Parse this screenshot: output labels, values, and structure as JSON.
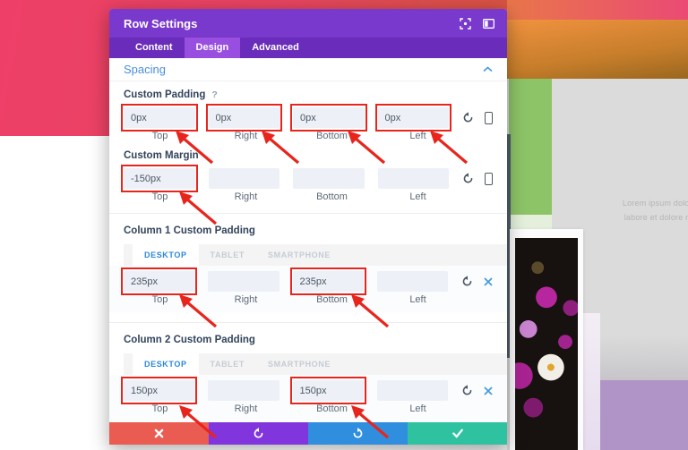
{
  "window": {
    "title": "Row Settings",
    "header_icons": [
      "expand-icon",
      "dock-icon"
    ]
  },
  "tabs": [
    {
      "label": "Content",
      "active": false
    },
    {
      "label": "Design",
      "active": true
    },
    {
      "label": "Advanced",
      "active": false
    }
  ],
  "section": {
    "title": "Spacing",
    "toggle_icon": "chevron-up-icon"
  },
  "groups": [
    {
      "label": "Custom Padding",
      "help": "?",
      "fields": [
        {
          "label": "Top",
          "value": "0px",
          "highlighted": true
        },
        {
          "label": "Right",
          "value": "0px",
          "highlighted": true
        },
        {
          "label": "Bottom",
          "value": "0px",
          "highlighted": true
        },
        {
          "label": "Left",
          "value": "0px",
          "highlighted": true
        }
      ],
      "actions": [
        "reset-icon",
        "phone-icon"
      ]
    },
    {
      "label": "Custom Margin",
      "fields": [
        {
          "label": "Top",
          "value": "-150px",
          "highlighted": true
        },
        {
          "label": "Right",
          "value": "",
          "highlighted": false
        },
        {
          "label": "Bottom",
          "value": "",
          "highlighted": false
        },
        {
          "label": "Left",
          "value": "",
          "highlighted": false
        }
      ],
      "actions": [
        "reset-icon",
        "phone-icon"
      ]
    },
    {
      "label": "Column 1 Custom Padding",
      "device_tabs": [
        {
          "label": "DESKTOP",
          "active": true
        },
        {
          "label": "TABLET",
          "active": false
        },
        {
          "label": "SMARTPHONE",
          "active": false
        }
      ],
      "fields": [
        {
          "label": "Top",
          "value": "235px",
          "highlighted": true
        },
        {
          "label": "Right",
          "value": "",
          "highlighted": false
        },
        {
          "label": "Bottom",
          "value": "235px",
          "highlighted": true
        },
        {
          "label": "Left",
          "value": "",
          "highlighted": false
        }
      ],
      "actions": [
        "reset-icon",
        "close-icon"
      ]
    },
    {
      "label": "Column 2 Custom Padding",
      "device_tabs": [
        {
          "label": "DESKTOP",
          "active": true
        },
        {
          "label": "TABLET",
          "active": false
        },
        {
          "label": "SMARTPHONE",
          "active": false
        }
      ],
      "fields": [
        {
          "label": "Top",
          "value": "150px",
          "highlighted": true
        },
        {
          "label": "Right",
          "value": "",
          "highlighted": false
        },
        {
          "label": "Bottom",
          "value": "150px",
          "highlighted": true
        },
        {
          "label": "Left",
          "value": "",
          "highlighted": false
        }
      ],
      "actions": [
        "reset-icon",
        "close-icon"
      ]
    }
  ],
  "footer": {
    "buttons": [
      {
        "name": "cancel",
        "icon": "x-icon",
        "color": "#ea5c51"
      },
      {
        "name": "undo",
        "icon": "undo-icon",
        "color": "#8135dc"
      },
      {
        "name": "redo",
        "icon": "redo-icon",
        "color": "#2f8ede"
      },
      {
        "name": "save",
        "icon": "check-icon",
        "color": "#2fc2a0"
      }
    ]
  },
  "background_page": {
    "paragraph_line1": "Lorem ipsum dolor sit",
    "paragraph_line2": "labore et dolore mag"
  },
  "colors": {
    "header_purple": "#7939cc",
    "tabbar_purple": "#6a2cbb",
    "active_tab_purple": "#984fe0",
    "accent_blue": "#2b87da",
    "annotation_red": "#e8251d",
    "input_bg": "#edf0f6"
  }
}
